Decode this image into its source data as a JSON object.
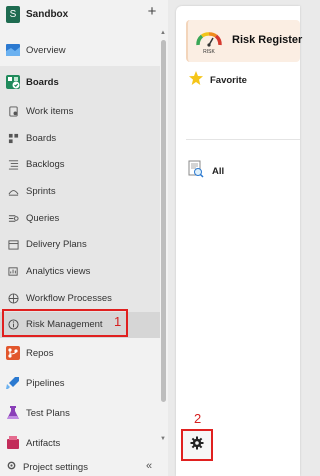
{
  "project": {
    "avatar_letter": "S",
    "name": "Sandbox",
    "add_symbol": "+"
  },
  "nav": {
    "overview": "Overview",
    "boards": "Boards",
    "work_items": "Work items",
    "boards_sub": "Boards",
    "backlogs": "Backlogs",
    "sprints": "Sprints",
    "queries": "Queries",
    "delivery_plans": "Delivery Plans",
    "analytics_views": "Analytics views",
    "workflow_processes": "Workflow Processes",
    "risk_management": "Risk Management",
    "repos": "Repos",
    "pipelines": "Pipelines",
    "test_plans": "Test Plans",
    "artifacts": "Artifacts"
  },
  "footer": {
    "project_settings": "Project settings",
    "collapse_symbol": "«"
  },
  "annotations": {
    "label_1": "1",
    "label_2": "2"
  },
  "panel": {
    "risk_register": "Risk Register",
    "gauge_text": "RISK",
    "favorite": "Favorite",
    "all": "All"
  },
  "colors": {
    "highlight": "#e0201f",
    "accent": "#1e6b50",
    "card_bg": "#fbeee3"
  }
}
